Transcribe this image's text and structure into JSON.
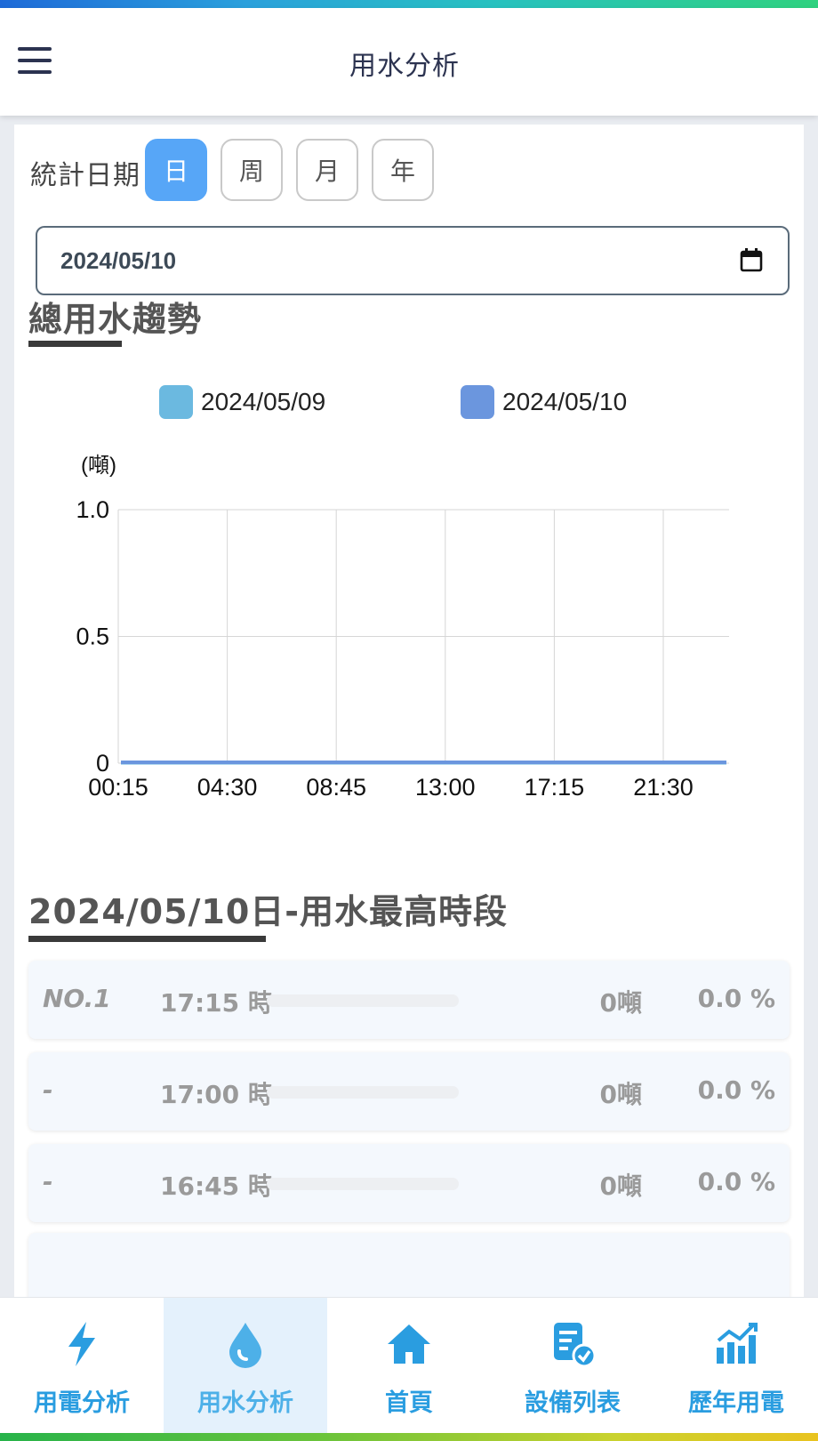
{
  "header": {
    "title": "用水分析"
  },
  "filter": {
    "label": "統計日期",
    "periods": [
      {
        "label": "日",
        "active": true
      },
      {
        "label": "周",
        "active": false
      },
      {
        "label": "月",
        "active": false
      },
      {
        "label": "年",
        "active": false
      }
    ],
    "date_value": "2024/05/10"
  },
  "trend": {
    "title": "總用水趨勢"
  },
  "chart_data": {
    "type": "line",
    "unit_label": "(噸)",
    "yticks": [
      "0",
      "0.5",
      "1.0"
    ],
    "ylim": [
      0,
      1
    ],
    "x": [
      "00:15",
      "04:30",
      "08:45",
      "13:00",
      "17:15",
      "21:30"
    ],
    "xlim_label_count": 6,
    "series": [
      {
        "name": "2024/05/09",
        "color": "#6bb9e0",
        "values": [
          0,
          0,
          0,
          0,
          0,
          0
        ]
      },
      {
        "name": "2024/05/10",
        "color": "#6b96de",
        "values": [
          0,
          0,
          0,
          0,
          0,
          0
        ]
      }
    ],
    "grid": true,
    "legend": "top"
  },
  "peak": {
    "title": "2024/05/10日-用水最高時段",
    "rows": [
      {
        "rank": "NO.1",
        "time": "17:15 時",
        "value": "0噸",
        "percent": "0.0 %",
        "fraction": 0
      },
      {
        "rank": "-",
        "time": "17:00 時",
        "value": "0噸",
        "percent": "0.0 %",
        "fraction": 0
      },
      {
        "rank": "-",
        "time": "16:45 時",
        "value": "0噸",
        "percent": "0.0 %",
        "fraction": 0
      }
    ]
  },
  "nav": {
    "items": [
      {
        "label": "用電分析",
        "icon": "lightning-icon",
        "active": false
      },
      {
        "label": "用水分析",
        "icon": "water-drop-icon",
        "active": true
      },
      {
        "label": "首頁",
        "icon": "home-icon",
        "active": false
      },
      {
        "label": "設備列表",
        "icon": "device-list-icon",
        "active": false
      },
      {
        "label": "歷年用電",
        "icon": "bar-chart-icon",
        "active": false
      }
    ],
    "color": "#2a9de0"
  }
}
